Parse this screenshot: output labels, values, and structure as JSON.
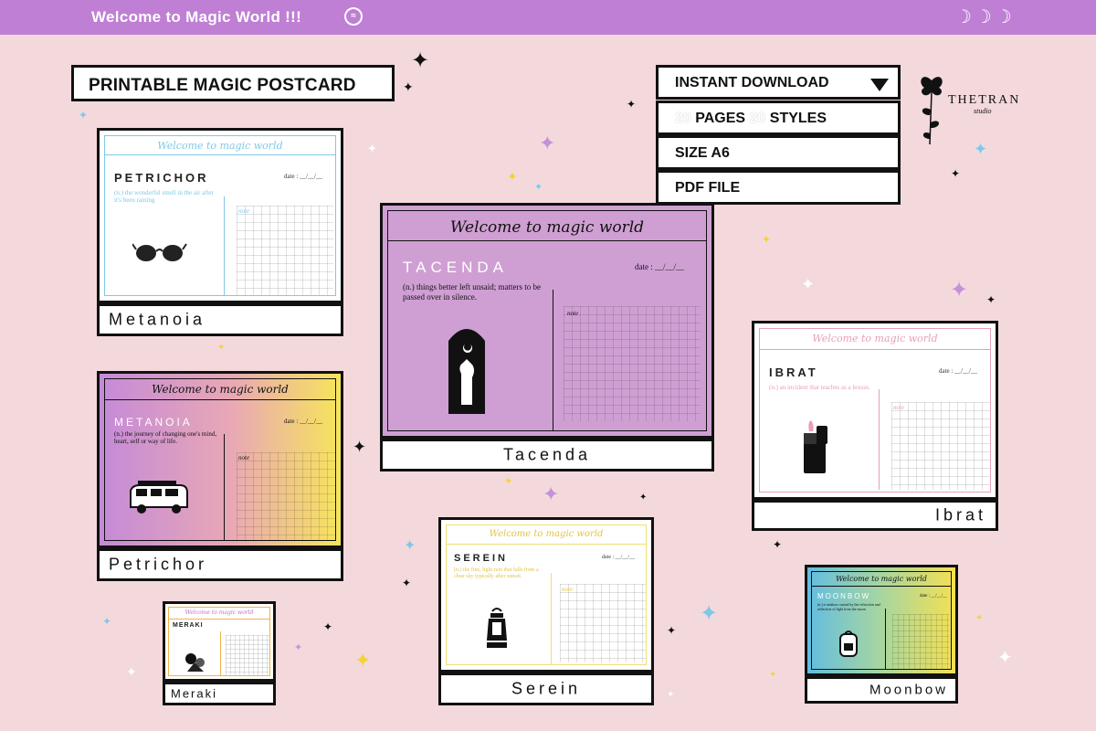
{
  "banner": {
    "title": "Welcome to Magic World !!!",
    "face_icon": "face-icon",
    "moons": "☽☽☽"
  },
  "header_label": "PRINTABLE MAGIC POSTCARD",
  "info": {
    "download": "INSTANT DOWNLOAD",
    "pages_num": "20",
    "pages_label": "PAGES",
    "styles_num": "20",
    "styles_label": "STYLES",
    "size": "SIZE A6",
    "file": "PDF FILE"
  },
  "logo": {
    "brand": "THETRAN",
    "studio": "studio",
    "icon": "rose-icon"
  },
  "card_header": "Welcome to magic world",
  "date_label": "date : __/__/__",
  "note_label": "note",
  "cards": [
    {
      "word": "PETRICHOR",
      "def": "(n.) the wonderful smell in the air after it's been raining",
      "caption": "Metanoia",
      "accent": "#7fc8e8",
      "icon": "sunglasses-icon"
    },
    {
      "word": "TACENDA",
      "def": "(n.) things better left unsaid; matters to be passed over in silence.",
      "caption": "Tacenda",
      "accent": "#ffffff",
      "icon": "hand-moon-icon"
    },
    {
      "word": "IBRAT",
      "def": "(n.) an incident that teaches as a lesson.",
      "caption": "Ibrat",
      "accent": "#e79fb5",
      "icon": "lighter-icon"
    },
    {
      "word": "METANOIA",
      "def": "(n.) the journey of changing one's mind, heart, self or way of life.",
      "caption": "Petrichor",
      "accent": "#ffffff",
      "icon": "van-icon"
    },
    {
      "word": "SEREIN",
      "def": "(n.) the fine, light rain that falls from a clear sky typically after sunset.",
      "caption": "Serein",
      "accent": "#f1df6f",
      "icon": "lantern-icon"
    },
    {
      "word": "MERAKI",
      "def": "",
      "caption": "Meraki",
      "accent": "#f0b44a",
      "icon": "flowers-icon"
    },
    {
      "word": "MOONBOW",
      "def": "(n.) a rainbow caused by the refraction and reflection of light from the moon",
      "caption": "Moonbow",
      "accent": "#ffffff",
      "icon": "backpack-icon"
    }
  ],
  "colors": {
    "background": "#f3d9dc",
    "banner": "#bf7fd4",
    "tacenda": "#cf9fd3",
    "frame": "#111111"
  }
}
